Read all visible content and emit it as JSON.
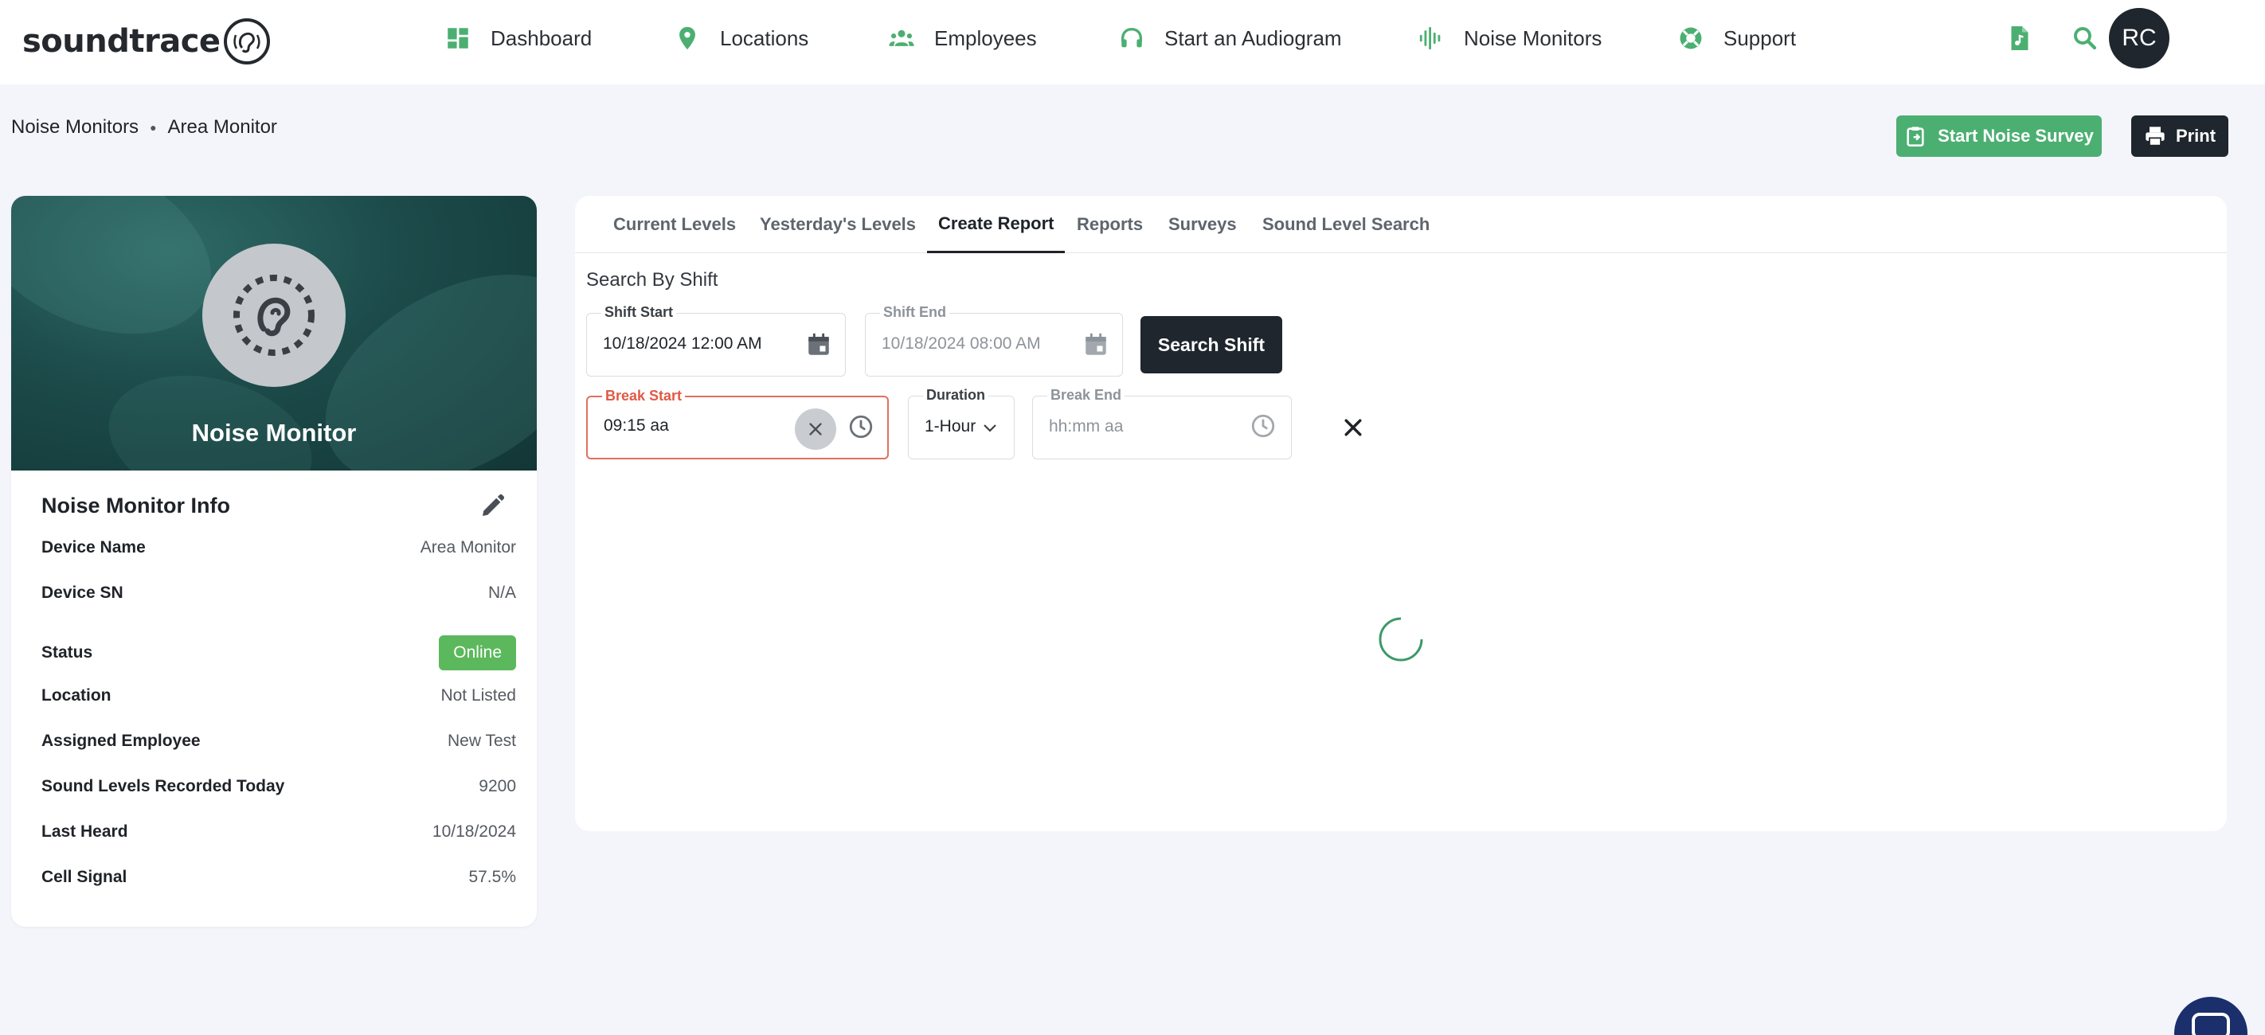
{
  "brand": {
    "name": "soundtrace"
  },
  "nav": {
    "items": [
      {
        "label": "Dashboard",
        "icon": "dashboard-icon"
      },
      {
        "label": "Locations",
        "icon": "location-pin-icon"
      },
      {
        "label": "Employees",
        "icon": "people-icon"
      },
      {
        "label": "Start an Audiogram",
        "icon": "headphones-icon"
      },
      {
        "label": "Noise Monitors",
        "icon": "sound-wave-icon"
      },
      {
        "label": "Support",
        "icon": "lifebuoy-icon"
      }
    ],
    "icon_color": "#4caf72",
    "user_initials": "RC"
  },
  "breadcrumb": {
    "parent": "Noise Monitors",
    "current": "Area Monitor"
  },
  "actions": {
    "survey_label": "Start Noise Survey",
    "print_label": "Print"
  },
  "device_card": {
    "hero_title": "Noise Monitor",
    "info_title": "Noise Monitor Info",
    "rows": [
      {
        "key": "Device Name",
        "value": "Area Monitor"
      },
      {
        "key": "Device SN",
        "value": "N/A"
      },
      {
        "key": "Status",
        "value": "Online"
      },
      {
        "key": "Location",
        "value": "Not Listed"
      },
      {
        "key": "Assigned Employee",
        "value": "New Test"
      },
      {
        "key": "Sound Levels Recorded Today",
        "value": "9200"
      },
      {
        "key": "Last Heard",
        "value": "10/18/2024"
      },
      {
        "key": "Cell Signal",
        "value": "57.5%"
      }
    ],
    "status_color": "#5cb85c"
  },
  "tabs": [
    {
      "label": "Current Levels",
      "active": false
    },
    {
      "label": "Yesterday's Levels",
      "active": false
    },
    {
      "label": "Create Report",
      "active": true
    },
    {
      "label": "Reports",
      "active": false
    },
    {
      "label": "Surveys",
      "active": false
    },
    {
      "label": "Sound Level Search",
      "active": false
    }
  ],
  "report": {
    "section_title": "Search By Shift",
    "shift_start": {
      "label": "Shift Start",
      "value": "10/18/2024 12:00 AM"
    },
    "shift_end": {
      "label": "Shift End",
      "value": "10/18/2024 08:00 AM"
    },
    "search_label": "Search Shift",
    "break_start": {
      "label": "Break Start",
      "value": "09:15 aa"
    },
    "duration": {
      "label": "Duration",
      "value": "1-Hour"
    },
    "break_end": {
      "label": "Break End",
      "placeholder": "hh:mm aa"
    }
  }
}
